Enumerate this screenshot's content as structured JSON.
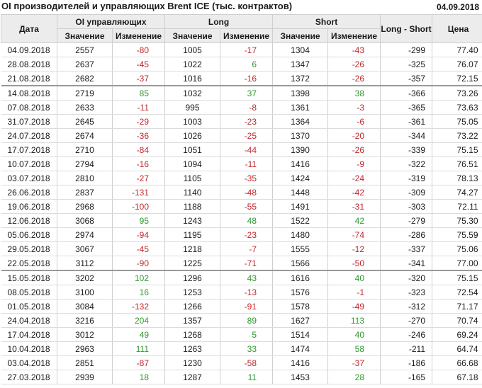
{
  "header": {
    "title": "OI производителей и управляющих Brent ICE (тыс. контрактов)",
    "date": "04.09.2018"
  },
  "columns": {
    "date": "Дата",
    "oi_group": "OI управляющих",
    "long_group": "Long",
    "short_group": "Short",
    "value": "Значение",
    "change": "Изменение",
    "long_short": "Long - Short",
    "price": "Цена"
  },
  "colors": {
    "positive": "#2e9a2e",
    "negative": "#c0272d",
    "header_bg": "#ececec"
  },
  "rows": [
    {
      "date": "04.09.2018",
      "oi": "2557",
      "oi_chg": "-80",
      "long": "1005",
      "long_chg": "-17",
      "short": "1304",
      "short_chg": "-43",
      "ls": "-299",
      "price": "77.40"
    },
    {
      "date": "28.08.2018",
      "oi": "2637",
      "oi_chg": "-45",
      "long": "1022",
      "long_chg": "6",
      "short": "1347",
      "short_chg": "-26",
      "ls": "-325",
      "price": "76.07"
    },
    {
      "date": "21.08.2018",
      "oi": "2682",
      "oi_chg": "-37",
      "long": "1016",
      "long_chg": "-16",
      "short": "1372",
      "short_chg": "-26",
      "ls": "-357",
      "price": "72.15"
    },
    {
      "date": "14.08.2018",
      "oi": "2719",
      "oi_chg": "85",
      "long": "1032",
      "long_chg": "37",
      "short": "1398",
      "short_chg": "38",
      "ls": "-366",
      "price": "73.26"
    },
    {
      "date": "07.08.2018",
      "oi": "2633",
      "oi_chg": "-11",
      "long": "995",
      "long_chg": "-8",
      "short": "1361",
      "short_chg": "-3",
      "ls": "-365",
      "price": "73.63"
    },
    {
      "date": "31.07.2018",
      "oi": "2645",
      "oi_chg": "-29",
      "long": "1003",
      "long_chg": "-23",
      "short": "1364",
      "short_chg": "-6",
      "ls": "-361",
      "price": "75.05"
    },
    {
      "date": "24.07.2018",
      "oi": "2674",
      "oi_chg": "-36",
      "long": "1026",
      "long_chg": "-25",
      "short": "1370",
      "short_chg": "-20",
      "ls": "-344",
      "price": "73.22"
    },
    {
      "date": "17.07.2018",
      "oi": "2710",
      "oi_chg": "-84",
      "long": "1051",
      "long_chg": "-44",
      "short": "1390",
      "short_chg": "-26",
      "ls": "-339",
      "price": "75.15"
    },
    {
      "date": "10.07.2018",
      "oi": "2794",
      "oi_chg": "-16",
      "long": "1094",
      "long_chg": "-11",
      "short": "1416",
      "short_chg": "-9",
      "ls": "-322",
      "price": "76.51"
    },
    {
      "date": "03.07.2018",
      "oi": "2810",
      "oi_chg": "-27",
      "long": "1105",
      "long_chg": "-35",
      "short": "1424",
      "short_chg": "-24",
      "ls": "-319",
      "price": "78.13"
    },
    {
      "date": "26.06.2018",
      "oi": "2837",
      "oi_chg": "-131",
      "long": "1140",
      "long_chg": "-48",
      "short": "1448",
      "short_chg": "-42",
      "ls": "-309",
      "price": "74.27"
    },
    {
      "date": "19.06.2018",
      "oi": "2968",
      "oi_chg": "-100",
      "long": "1188",
      "long_chg": "-55",
      "short": "1491",
      "short_chg": "-31",
      "ls": "-303",
      "price": "72.11"
    },
    {
      "date": "12.06.2018",
      "oi": "3068",
      "oi_chg": "95",
      "long": "1243",
      "long_chg": "48",
      "short": "1522",
      "short_chg": "42",
      "ls": "-279",
      "price": "75.30"
    },
    {
      "date": "05.06.2018",
      "oi": "2974",
      "oi_chg": "-94",
      "long": "1195",
      "long_chg": "-23",
      "short": "1480",
      "short_chg": "-74",
      "ls": "-286",
      "price": "75.59"
    },
    {
      "date": "29.05.2018",
      "oi": "3067",
      "oi_chg": "-45",
      "long": "1218",
      "long_chg": "-7",
      "short": "1555",
      "short_chg": "-12",
      "ls": "-337",
      "price": "75.06"
    },
    {
      "date": "22.05.2018",
      "oi": "3112",
      "oi_chg": "-90",
      "long": "1225",
      "long_chg": "-71",
      "short": "1566",
      "short_chg": "-50",
      "ls": "-341",
      "price": "77.00"
    },
    {
      "date": "15.05.2018",
      "oi": "3202",
      "oi_chg": "102",
      "long": "1296",
      "long_chg": "43",
      "short": "1616",
      "short_chg": "40",
      "ls": "-320",
      "price": "75.15"
    },
    {
      "date": "08.05.2018",
      "oi": "3100",
      "oi_chg": "16",
      "long": "1253",
      "long_chg": "-13",
      "short": "1576",
      "short_chg": "-1",
      "ls": "-323",
      "price": "72.54"
    },
    {
      "date": "01.05.2018",
      "oi": "3084",
      "oi_chg": "-132",
      "long": "1266",
      "long_chg": "-91",
      "short": "1578",
      "short_chg": "-49",
      "ls": "-312",
      "price": "71.17"
    },
    {
      "date": "24.04.2018",
      "oi": "3216",
      "oi_chg": "204",
      "long": "1357",
      "long_chg": "89",
      "short": "1627",
      "short_chg": "113",
      "ls": "-270",
      "price": "70.74"
    },
    {
      "date": "17.04.2018",
      "oi": "3012",
      "oi_chg": "49",
      "long": "1268",
      "long_chg": "5",
      "short": "1514",
      "short_chg": "40",
      "ls": "-246",
      "price": "69.24"
    },
    {
      "date": "10.04.2018",
      "oi": "2963",
      "oi_chg": "111",
      "long": "1263",
      "long_chg": "33",
      "short": "1474",
      "short_chg": "58",
      "ls": "-211",
      "price": "64.74"
    },
    {
      "date": "03.04.2018",
      "oi": "2851",
      "oi_chg": "-87",
      "long": "1230",
      "long_chg": "-58",
      "short": "1416",
      "short_chg": "-37",
      "ls": "-186",
      "price": "66.68"
    },
    {
      "date": "27.03.2018",
      "oi": "2939",
      "oi_chg": "18",
      "long": "1287",
      "long_chg": "11",
      "short": "1453",
      "short_chg": "28",
      "ls": "-165",
      "price": "67.18"
    }
  ]
}
